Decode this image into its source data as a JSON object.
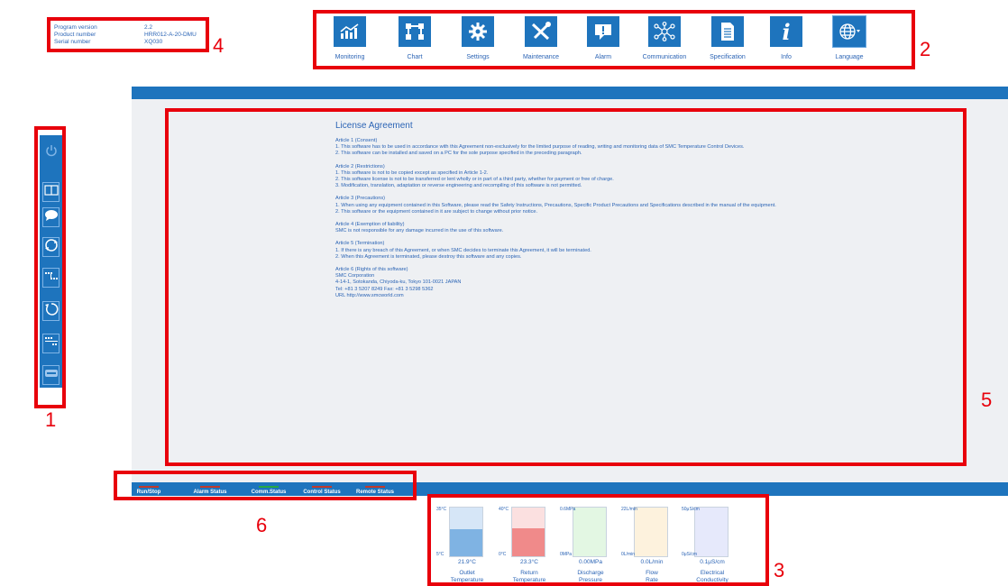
{
  "info": {
    "rows": [
      {
        "label": "Program version",
        "value": "2.2"
      },
      {
        "label": "Product number",
        "value": "HRR012-A-20-DMU"
      },
      {
        "label": "Serial number",
        "value": "XQ030"
      }
    ]
  },
  "toolbar": {
    "items": [
      {
        "label": "Monitoring",
        "icon": "monitoring-icon"
      },
      {
        "label": "Chart",
        "icon": "chart-icon"
      },
      {
        "label": "Settings",
        "icon": "gear-icon"
      },
      {
        "label": "Maintenance",
        "icon": "tools-icon"
      },
      {
        "label": "Alarm",
        "icon": "alarm-icon"
      },
      {
        "label": "Communication",
        "icon": "network-icon"
      },
      {
        "label": "Specification",
        "icon": "document-icon"
      },
      {
        "label": "Info",
        "icon": "info-icon"
      },
      {
        "label": "Language",
        "icon": "globe-icon"
      }
    ]
  },
  "sidebar": {
    "items": [
      "power-icon",
      "panel-icon",
      "message-icon",
      "refresh-icon",
      "sequence-icon",
      "reset-icon",
      "list-icon",
      "keyboard-icon"
    ]
  },
  "license": {
    "title": "License Agreement",
    "articles": [
      [
        "Article 1 (Consent)",
        "1. This software has to be used in accordance with this Agreement non-exclusively for the limited purpose of reading, writing and monitoring data of SMC Temperature Control Devices.",
        "2. This software can be installed and saved on a PC for the sole purpose specified in the preceding paragraph."
      ],
      [
        "Article 2 (Restrictions)",
        "1. This software is not to be copied except as specified in Article 1-2.",
        "2. This software license is not to be transferred or lent wholly or in part of a third party, whether for payment or free of charge.",
        "3. Modification, translation, adaptation or reverse engineering and recompiling of this software is not permitted."
      ],
      [
        "Article 3 (Precautions)",
        "1. When using any equipment contained in this Software, please read the Safety Instructions, Precautions, Specific Product Precautions and Specifications described in the manual of the equipment.",
        "2. This software or the equipment contained in it are subject to change without prior notice."
      ],
      [
        "Article 4 (Exemption of liability)",
        "SMC is not responsible for any damage incurred in the use of this software."
      ],
      [
        "Article 5 (Termination)",
        "1. If there is any breach of this Agreement, or when SMC decides to terminate this Agreement, it will be terminated.",
        "2. When this Agreement is terminated, please destroy this software and any copies."
      ],
      [
        "Article 6 (Rights of this software)",
        "SMC Corporation",
        "4-14-1, Sotokanda, Chiyoda-ku, Tokyo 101-0021 JAPAN",
        "Tel: +81 3 5207 8249 Fax: +81 3 5298 5362",
        "URL http://www.smcworld.com"
      ]
    ]
  },
  "status": {
    "items": [
      {
        "label": "Run/Stop",
        "color": "#c0392b"
      },
      {
        "label": "Alarm Status",
        "color": "#c0392b"
      },
      {
        "label": "Comm.Status",
        "color": "#27a844"
      },
      {
        "label": "Control Status",
        "color": "#c0392b"
      },
      {
        "label": "Remote Status",
        "color": "#c0392b"
      }
    ]
  },
  "gauges": [
    {
      "max": "35°C",
      "min": "5°C",
      "value": "21.9°C",
      "name": "Outlet\nTemperature",
      "color": "#d6e6f7",
      "fill": 0.56,
      "fill_color": "#7fb3e3"
    },
    {
      "max": "40°C",
      "min": "0°C",
      "value": "23.3°C",
      "name": "Return\nTemperature",
      "color": "#fbe0e0",
      "fill": 0.58,
      "fill_color": "#f08a8a"
    },
    {
      "max": "0.6MPa",
      "min": "0MPa",
      "value": "0.00MPa",
      "name": "Discharge\nPressure",
      "color": "#e3f7e3",
      "fill": 0.0,
      "fill_color": "#a3e2a3"
    },
    {
      "max": "22L/min",
      "min": "0L/min",
      "value": "0.0L/min",
      "name": "Flow\nRate",
      "color": "#fdf2dd",
      "fill": 0.0,
      "fill_color": "#f6d08a"
    },
    {
      "max": "50μS/cm",
      "min": "0μS/cm",
      "value": "0.1μS/cm",
      "name": "Electrical\nConductivity",
      "color": "#e6e9fb",
      "fill": 0.0,
      "fill_color": "#a8b1ee"
    }
  ],
  "callouts": [
    "1",
    "2",
    "3",
    "4",
    "5",
    "6"
  ]
}
